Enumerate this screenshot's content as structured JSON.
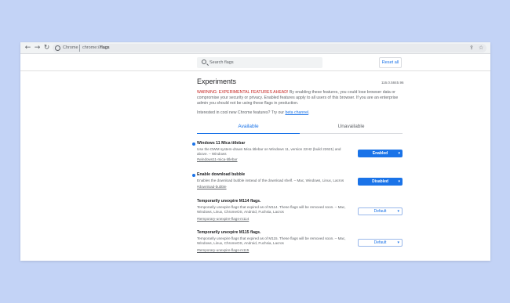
{
  "browser": {
    "omnibox_chrome_label": "Chrome",
    "omnibox_url_scheme": "chrome://",
    "omnibox_url_path": "flags",
    "icons": [
      "back-arrow-icon",
      "forward-arrow-icon",
      "reload-icon",
      "site-info-icon",
      "share-icon",
      "star-icon"
    ]
  },
  "search": {
    "placeholder": "Search flags",
    "reset_label": "Reset all"
  },
  "page": {
    "title": "Experiments",
    "version": "116.0.5845.96",
    "warning_prefix": "WARNING: EXPERIMENTAL FEATURES AHEAD!",
    "warning_body": " By enabling these features, you could lose browser data or compromise your security or privacy. Enabled features apply to all users of this browser. If you are an enterprise admin you should not be using these flags in production.",
    "interest_text": "Interested in cool new Chrome features? Try our ",
    "interest_link": "beta channel",
    "interest_suffix": "."
  },
  "tabs": [
    {
      "label": "Available",
      "active": true
    },
    {
      "label": "Unavailable",
      "active": false
    }
  ],
  "flags": [
    {
      "title": "Windows 11 Mica titlebar",
      "description": "Use the DWM system-drawn Mica titlebar on Windows 11, version 22H2 (build 22621) and above. – Windows",
      "link": "#windows11-mica-titlebar",
      "state": "Enabled",
      "modified": true
    },
    {
      "title": "Enable download bubble",
      "description": "Enables the download bubble instead of the download shelf. – Mac, Windows, Linux, Lacros",
      "link": "#download-bubble",
      "state": "Disabled",
      "modified": true
    },
    {
      "title": "Temporarily unexpire M114 flags.",
      "description": "Temporarily unexpire flags that expired as of M114. These flags will be removed soon. – Mac, Windows, Linux, ChromeOS, Android, Fuchsia, Lacros",
      "link": "#temporary-unexpire-flags-m114",
      "state": "Default",
      "modified": false
    },
    {
      "title": "Temporarily unexpire M115 flags.",
      "description": "Temporarily unexpire flags that expired as of M115. These flags will be removed soon. – Mac, Windows, Linux, ChromeOS, Android, Fuchsia, Lacros",
      "link": "#temporary-unexpire-flags-m115",
      "state": "Default",
      "modified": false
    }
  ],
  "colors": {
    "background": "#c3d3f6",
    "accent": "#1a73e8",
    "warning": "#c5221f"
  }
}
